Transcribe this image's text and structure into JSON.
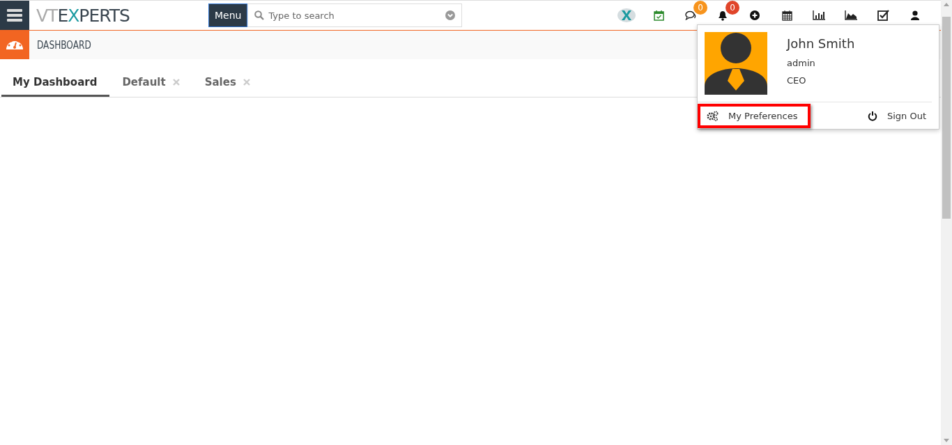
{
  "topbar": {
    "logo_parts": [
      "VT",
      "E",
      "X",
      "PERTS"
    ],
    "menu_button": "Menu",
    "search": {
      "placeholder": "Type to search"
    },
    "toolbar": [
      {
        "kind": "brand"
      },
      {
        "kind": "calendar-check"
      },
      {
        "kind": "chat",
        "badge": "0",
        "color": "#f7941d"
      },
      {
        "kind": "bell",
        "badge": "0",
        "color": "#e0452a"
      },
      {
        "kind": "plus"
      },
      {
        "kind": "calendar"
      },
      {
        "kind": "bar-chart"
      },
      {
        "kind": "area-chart"
      },
      {
        "kind": "checkbox"
      },
      {
        "kind": "user"
      }
    ]
  },
  "header": {
    "title": "DASHBOARD"
  },
  "tabs": [
    {
      "label": "My Dashboard",
      "selected": true,
      "closable": false
    },
    {
      "label": "Default",
      "selected": false,
      "closable": true
    },
    {
      "label": "Sales",
      "selected": false,
      "closable": true
    }
  ],
  "user_menu": {
    "name": "John Smith",
    "username": "admin",
    "role": "CEO",
    "actions": [
      {
        "kind": "preferences",
        "label": "My Preferences",
        "highlighted": true
      },
      {
        "kind": "sign-out",
        "label": "Sign Out",
        "highlighted": false
      }
    ]
  }
}
